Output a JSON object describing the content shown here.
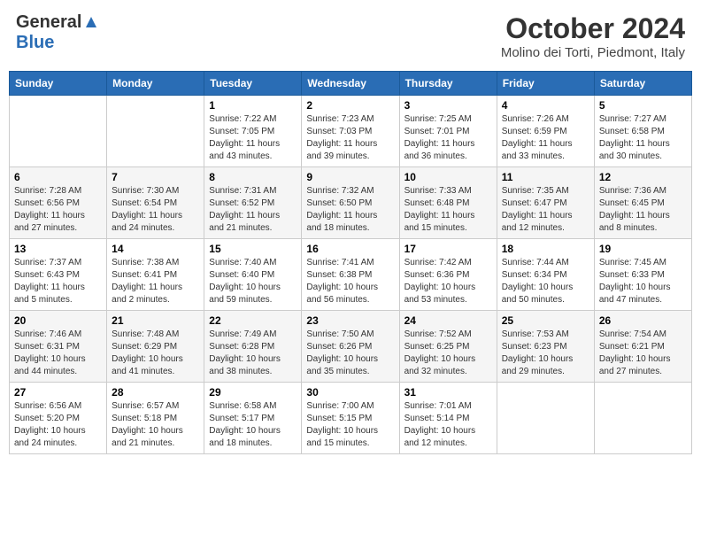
{
  "header": {
    "logo_general": "General",
    "logo_blue": "Blue",
    "month": "October 2024",
    "location": "Molino dei Torti, Piedmont, Italy"
  },
  "days_of_week": [
    "Sunday",
    "Monday",
    "Tuesday",
    "Wednesday",
    "Thursday",
    "Friday",
    "Saturday"
  ],
  "weeks": [
    [
      {
        "day": "",
        "sunrise": "",
        "sunset": "",
        "daylight": ""
      },
      {
        "day": "",
        "sunrise": "",
        "sunset": "",
        "daylight": ""
      },
      {
        "day": "1",
        "sunrise": "Sunrise: 7:22 AM",
        "sunset": "Sunset: 7:05 PM",
        "daylight": "Daylight: 11 hours and 43 minutes."
      },
      {
        "day": "2",
        "sunrise": "Sunrise: 7:23 AM",
        "sunset": "Sunset: 7:03 PM",
        "daylight": "Daylight: 11 hours and 39 minutes."
      },
      {
        "day": "3",
        "sunrise": "Sunrise: 7:25 AM",
        "sunset": "Sunset: 7:01 PM",
        "daylight": "Daylight: 11 hours and 36 minutes."
      },
      {
        "day": "4",
        "sunrise": "Sunrise: 7:26 AM",
        "sunset": "Sunset: 6:59 PM",
        "daylight": "Daylight: 11 hours and 33 minutes."
      },
      {
        "day": "5",
        "sunrise": "Sunrise: 7:27 AM",
        "sunset": "Sunset: 6:58 PM",
        "daylight": "Daylight: 11 hours and 30 minutes."
      }
    ],
    [
      {
        "day": "6",
        "sunrise": "Sunrise: 7:28 AM",
        "sunset": "Sunset: 6:56 PM",
        "daylight": "Daylight: 11 hours and 27 minutes."
      },
      {
        "day": "7",
        "sunrise": "Sunrise: 7:30 AM",
        "sunset": "Sunset: 6:54 PM",
        "daylight": "Daylight: 11 hours and 24 minutes."
      },
      {
        "day": "8",
        "sunrise": "Sunrise: 7:31 AM",
        "sunset": "Sunset: 6:52 PM",
        "daylight": "Daylight: 11 hours and 21 minutes."
      },
      {
        "day": "9",
        "sunrise": "Sunrise: 7:32 AM",
        "sunset": "Sunset: 6:50 PM",
        "daylight": "Daylight: 11 hours and 18 minutes."
      },
      {
        "day": "10",
        "sunrise": "Sunrise: 7:33 AM",
        "sunset": "Sunset: 6:48 PM",
        "daylight": "Daylight: 11 hours and 15 minutes."
      },
      {
        "day": "11",
        "sunrise": "Sunrise: 7:35 AM",
        "sunset": "Sunset: 6:47 PM",
        "daylight": "Daylight: 11 hours and 12 minutes."
      },
      {
        "day": "12",
        "sunrise": "Sunrise: 7:36 AM",
        "sunset": "Sunset: 6:45 PM",
        "daylight": "Daylight: 11 hours and 8 minutes."
      }
    ],
    [
      {
        "day": "13",
        "sunrise": "Sunrise: 7:37 AM",
        "sunset": "Sunset: 6:43 PM",
        "daylight": "Daylight: 11 hours and 5 minutes."
      },
      {
        "day": "14",
        "sunrise": "Sunrise: 7:38 AM",
        "sunset": "Sunset: 6:41 PM",
        "daylight": "Daylight: 11 hours and 2 minutes."
      },
      {
        "day": "15",
        "sunrise": "Sunrise: 7:40 AM",
        "sunset": "Sunset: 6:40 PM",
        "daylight": "Daylight: 10 hours and 59 minutes."
      },
      {
        "day": "16",
        "sunrise": "Sunrise: 7:41 AM",
        "sunset": "Sunset: 6:38 PM",
        "daylight": "Daylight: 10 hours and 56 minutes."
      },
      {
        "day": "17",
        "sunrise": "Sunrise: 7:42 AM",
        "sunset": "Sunset: 6:36 PM",
        "daylight": "Daylight: 10 hours and 53 minutes."
      },
      {
        "day": "18",
        "sunrise": "Sunrise: 7:44 AM",
        "sunset": "Sunset: 6:34 PM",
        "daylight": "Daylight: 10 hours and 50 minutes."
      },
      {
        "day": "19",
        "sunrise": "Sunrise: 7:45 AM",
        "sunset": "Sunset: 6:33 PM",
        "daylight": "Daylight: 10 hours and 47 minutes."
      }
    ],
    [
      {
        "day": "20",
        "sunrise": "Sunrise: 7:46 AM",
        "sunset": "Sunset: 6:31 PM",
        "daylight": "Daylight: 10 hours and 44 minutes."
      },
      {
        "day": "21",
        "sunrise": "Sunrise: 7:48 AM",
        "sunset": "Sunset: 6:29 PM",
        "daylight": "Daylight: 10 hours and 41 minutes."
      },
      {
        "day": "22",
        "sunrise": "Sunrise: 7:49 AM",
        "sunset": "Sunset: 6:28 PM",
        "daylight": "Daylight: 10 hours and 38 minutes."
      },
      {
        "day": "23",
        "sunrise": "Sunrise: 7:50 AM",
        "sunset": "Sunset: 6:26 PM",
        "daylight": "Daylight: 10 hours and 35 minutes."
      },
      {
        "day": "24",
        "sunrise": "Sunrise: 7:52 AM",
        "sunset": "Sunset: 6:25 PM",
        "daylight": "Daylight: 10 hours and 32 minutes."
      },
      {
        "day": "25",
        "sunrise": "Sunrise: 7:53 AM",
        "sunset": "Sunset: 6:23 PM",
        "daylight": "Daylight: 10 hours and 29 minutes."
      },
      {
        "day": "26",
        "sunrise": "Sunrise: 7:54 AM",
        "sunset": "Sunset: 6:21 PM",
        "daylight": "Daylight: 10 hours and 27 minutes."
      }
    ],
    [
      {
        "day": "27",
        "sunrise": "Sunrise: 6:56 AM",
        "sunset": "Sunset: 5:20 PM",
        "daylight": "Daylight: 10 hours and 24 minutes."
      },
      {
        "day": "28",
        "sunrise": "Sunrise: 6:57 AM",
        "sunset": "Sunset: 5:18 PM",
        "daylight": "Daylight: 10 hours and 21 minutes."
      },
      {
        "day": "29",
        "sunrise": "Sunrise: 6:58 AM",
        "sunset": "Sunset: 5:17 PM",
        "daylight": "Daylight: 10 hours and 18 minutes."
      },
      {
        "day": "30",
        "sunrise": "Sunrise: 7:00 AM",
        "sunset": "Sunset: 5:15 PM",
        "daylight": "Daylight: 10 hours and 15 minutes."
      },
      {
        "day": "31",
        "sunrise": "Sunrise: 7:01 AM",
        "sunset": "Sunset: 5:14 PM",
        "daylight": "Daylight: 10 hours and 12 minutes."
      },
      {
        "day": "",
        "sunrise": "",
        "sunset": "",
        "daylight": ""
      },
      {
        "day": "",
        "sunrise": "",
        "sunset": "",
        "daylight": ""
      }
    ]
  ]
}
